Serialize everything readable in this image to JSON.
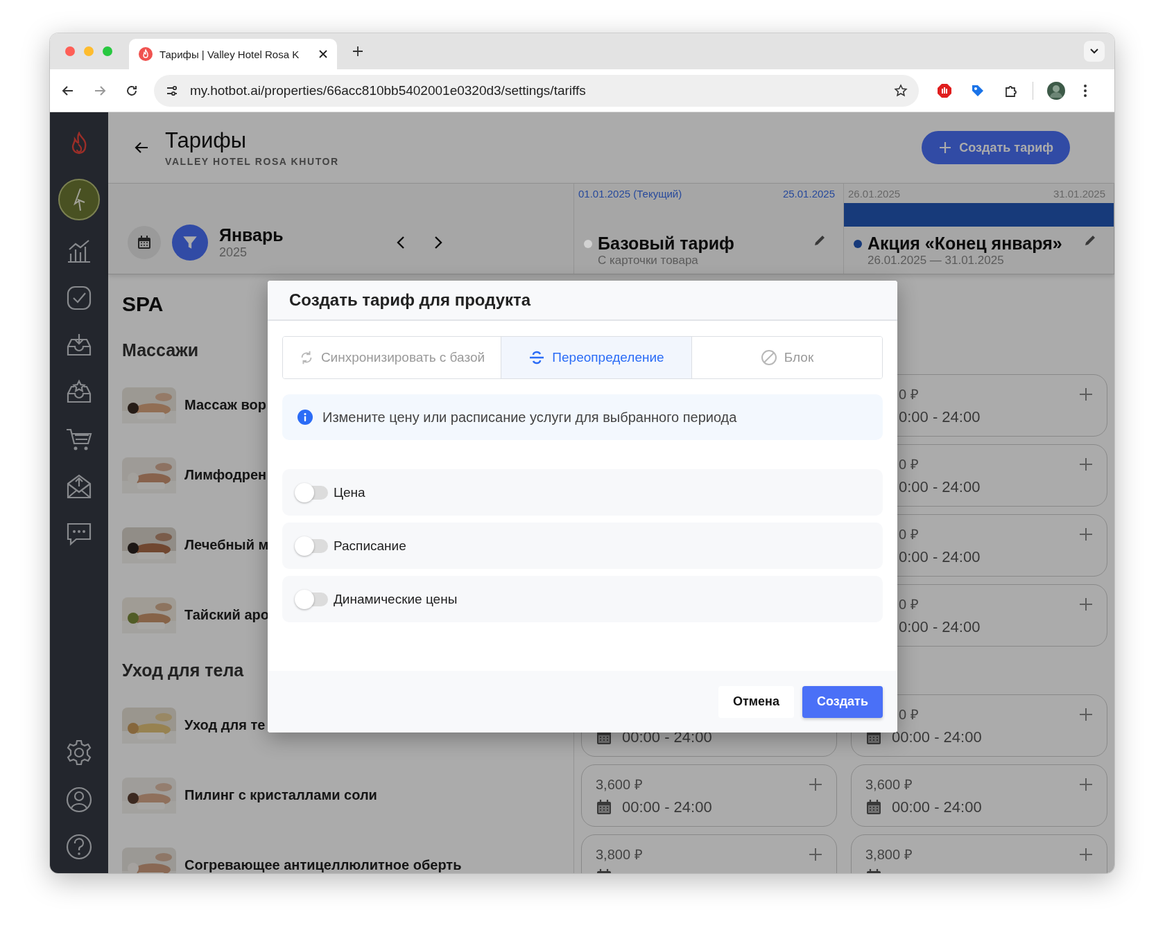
{
  "browser": {
    "tab_title": "Тарифы | Valley Hotel Rosa K",
    "url": "my.hotbot.ai/properties/66acc810bb5402001e0320d3/settings/tariffs"
  },
  "header": {
    "title": "Тарифы",
    "subtitle": "VALLEY HOTEL ROSA KHUTOR",
    "create_button": "Создать тариф"
  },
  "period": {
    "month": "Январь",
    "year": "2025"
  },
  "tariffs": [
    {
      "start": "01.01.2025 (Текущий)",
      "end": "25.01.2025",
      "current": true,
      "bar": false,
      "color": "#d2d2d2",
      "name": "Базовый тариф",
      "detail": "С карточки товара"
    },
    {
      "start": "26.01.2025",
      "end": "31.01.2025",
      "current": false,
      "bar": true,
      "color": "#173a7a",
      "name": "Акция «Конец января»",
      "detail": "26.01.2025 — 31.01.2025"
    }
  ],
  "catalog": {
    "title": "SPA",
    "sections": [
      {
        "title": "Массажи",
        "items": [
          {
            "name": "Массаж вор",
            "promo": {
              "kind": "covered",
              "price": "0 ₽",
              "time": "0:00 - 24:00"
            }
          },
          {
            "name": "Лимфодрен",
            "promo": {
              "kind": "covered",
              "price": "0 ₽",
              "time": "0:00 - 24:00"
            }
          },
          {
            "name": "Лечебный м",
            "promo": {
              "kind": "covered",
              "price": "0 ₽",
              "time": "0:00 - 24:00"
            }
          },
          {
            "name": "Тайский аро",
            "promo": {
              "kind": "covered",
              "price": "0 ₽",
              "time": "0:00 - 24:00"
            }
          }
        ]
      },
      {
        "title": "Уход для тела",
        "items": [
          {
            "name": "Уход для те",
            "base": {
              "kind": "full",
              "time": "00:00 - 24:00"
            },
            "promo": {
              "kind": "partial",
              "price": "0 ₽",
              "time": "00:00 - 24:00"
            }
          },
          {
            "name": "Пилинг с кристаллами соли",
            "base": {
              "kind": "full",
              "price": "3,600 ₽",
              "time": "00:00 - 24:00"
            },
            "promo": {
              "kind": "full",
              "price": "3,600 ₽",
              "time": "00:00 - 24:00"
            }
          },
          {
            "name": "Согревающее антицеллюлитное оберть",
            "base": {
              "kind": "full",
              "price": "3,800 ₽"
            },
            "promo": {
              "kind": "full",
              "price": "3,800 ₽"
            }
          }
        ]
      }
    ]
  },
  "dialog": {
    "title": "Создать тариф для продукта",
    "modes": [
      {
        "kind": "sync",
        "label": "Синхронизировать с базой",
        "selected": false
      },
      {
        "kind": "override",
        "label": "Переопределение",
        "selected": true
      },
      {
        "kind": "block",
        "label": "Блок",
        "selected": false
      }
    ],
    "info": "Измените цену или расписание услуги для выбранного периода",
    "options": [
      {
        "label": "Цена",
        "on": false
      },
      {
        "label": "Расписание",
        "on": false
      },
      {
        "label": "Динамические цены",
        "on": false
      }
    ],
    "buttons": [
      {
        "kind": "secondary",
        "label": "Отмена"
      },
      {
        "kind": "primary",
        "label": "Создать"
      }
    ]
  }
}
